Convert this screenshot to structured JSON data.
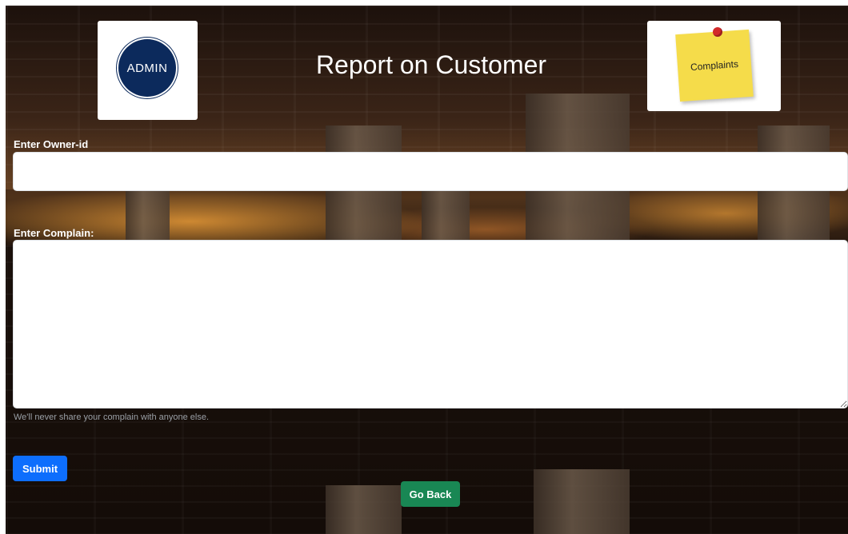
{
  "header": {
    "title": "Report on Customer",
    "admin_logo_text": "ADMIN",
    "complaints_logo_text": "Complaints"
  },
  "form": {
    "owner_label": "Enter Owner-id",
    "owner_value": "",
    "complain_label": "Enter Complain:",
    "complain_value": "",
    "help_text": "We'll never share your complain with anyone else.",
    "submit_label": "Submit",
    "back_label": "Go Back"
  },
  "colors": {
    "submit": "#0d6efd",
    "back": "#198754",
    "admin_badge": "#0c2a5c",
    "sticky_note": "#f5dc4a"
  }
}
